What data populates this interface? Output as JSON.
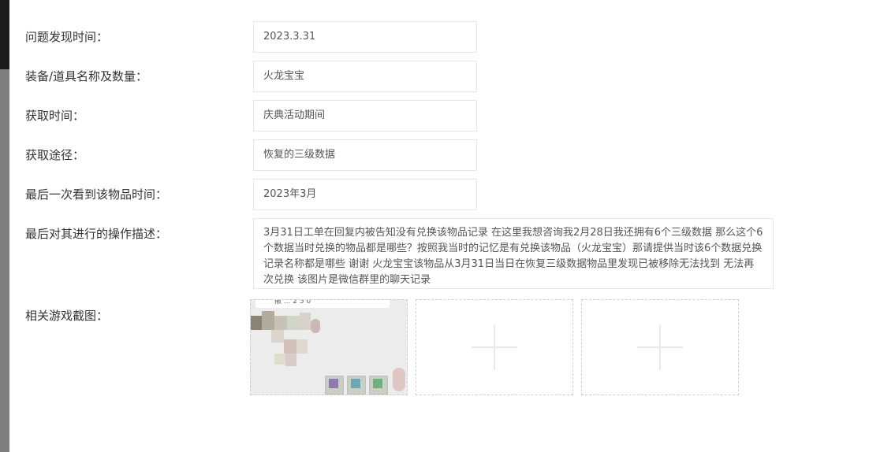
{
  "form": {
    "rows": [
      {
        "label": "问题发现时间：",
        "value": "2023.3.31"
      },
      {
        "label": "装备/道具名称及数量：",
        "value": "火龙宝宝"
      },
      {
        "label": "获取时间：",
        "value": "庆典活动期间"
      },
      {
        "label": "获取途径：",
        "value": "恢复的三级数据"
      },
      {
        "label": "最后一次看到该物品时间：",
        "value": "2023年3月"
      },
      {
        "label": "最后对其进行的操作描述：",
        "value": "3月31日工单在回复内被告知没有兑换该物品记录  在这里我想咨询我2月28日我还拥有6个三级数据  那么这个6个数据当时兑换的物品都是哪些？按照我当时的记忆是有兑换该物品（火龙宝宝）那请提供当时该6个数据兑换记录名称都是哪些 谢谢 火龙宝宝该物品从3月31日当日在恢复三级数据物品里发现已被移除无法找到 无法再次兑换   该图片是微信群里的聊天记录"
      }
    ],
    "screenshots": {
      "label": "相关游戏截图：",
      "thumb_caption": "撤 ... 2 5 0"
    }
  }
}
